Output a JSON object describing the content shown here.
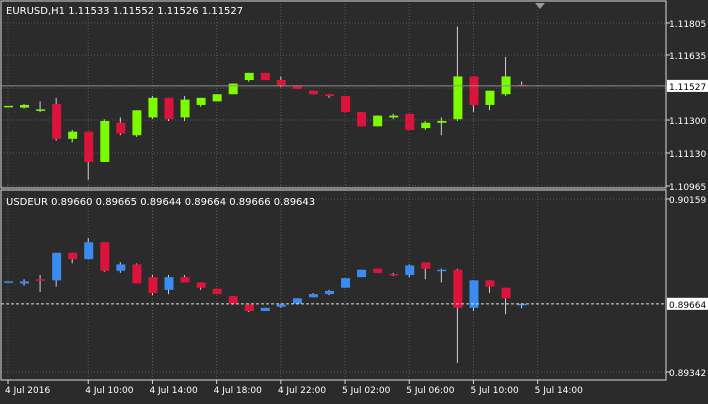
{
  "colors": {
    "background": "#2b2b2b",
    "grid": "#5a5a5a",
    "frame": "#d8d8d8",
    "text": "#ffffff",
    "bull_top": "#7cfc00",
    "bear_top": "#dc143c",
    "bull_bottom": "#3b8cf0",
    "bear_bottom": "#dc143c",
    "level_line": "#8c8c8c",
    "price_tag_bg": "#ffffff",
    "price_tag_text": "#000000"
  },
  "chart_data": [
    {
      "type": "candlestick",
      "title": "EURUSD,H1  1.11533 1.11552 1.11526 1.11527",
      "ylim": [
        1.10965,
        1.1188
      ],
      "yticks": [
        "1.11805",
        "1.11635",
        "1.11470",
        "1.11300",
        "1.11130",
        "1.10965"
      ],
      "current_price": "1.11527",
      "current_price_value": 1.11527,
      "candles": [
        {
          "o": 1.11415,
          "h": 1.11415,
          "l": 1.11415,
          "c": 1.11415
        },
        {
          "o": 1.11405,
          "h": 1.11425,
          "l": 1.114,
          "c": 1.1142
        },
        {
          "o": 1.11395,
          "h": 1.1144,
          "l": 1.1138,
          "c": 1.11395
        },
        {
          "o": 1.11425,
          "h": 1.1146,
          "l": 1.1122,
          "c": 1.1123
        },
        {
          "o": 1.1123,
          "h": 1.1128,
          "l": 1.1121,
          "c": 1.1127
        },
        {
          "o": 1.1127,
          "h": 1.1127,
          "l": 1.11,
          "c": 1.111
        },
        {
          "o": 1.111,
          "h": 1.1134,
          "l": 1.111,
          "c": 1.1133
        },
        {
          "o": 1.1132,
          "h": 1.1135,
          "l": 1.1125,
          "c": 1.1126
        },
        {
          "o": 1.1125,
          "h": 1.1139,
          "l": 1.1124,
          "c": 1.1139
        },
        {
          "o": 1.1135,
          "h": 1.1147,
          "l": 1.1134,
          "c": 1.1146
        },
        {
          "o": 1.1146,
          "h": 1.1146,
          "l": 1.1133,
          "c": 1.1134
        },
        {
          "o": 1.1135,
          "h": 1.1147,
          "l": 1.1133,
          "c": 1.1145
        },
        {
          "o": 1.1142,
          "h": 1.1146,
          "l": 1.1141,
          "c": 1.1146
        },
        {
          "o": 1.1144,
          "h": 1.1148,
          "l": 1.1144,
          "c": 1.1148
        },
        {
          "o": 1.1148,
          "h": 1.1154,
          "l": 1.1148,
          "c": 1.1154
        },
        {
          "o": 1.1156,
          "h": 1.116,
          "l": 1.1155,
          "c": 1.116
        },
        {
          "o": 1.116,
          "h": 1.116,
          "l": 1.1156,
          "c": 1.1156
        },
        {
          "o": 1.1156,
          "h": 1.1158,
          "l": 1.1152,
          "c": 1.1153
        },
        {
          "o": 1.1153,
          "h": 1.1153,
          "l": 1.1151,
          "c": 1.1151
        },
        {
          "o": 1.115,
          "h": 1.115,
          "l": 1.1148,
          "c": 1.1148
        },
        {
          "o": 1.1148,
          "h": 1.1148,
          "l": 1.1146,
          "c": 1.1147
        },
        {
          "o": 1.1147,
          "h": 1.1147,
          "l": 1.1138,
          "c": 1.1138
        },
        {
          "o": 1.1138,
          "h": 1.1138,
          "l": 1.113,
          "c": 1.113
        },
        {
          "o": 1.113,
          "h": 1.1136,
          "l": 1.113,
          "c": 1.1136
        },
        {
          "o": 1.1135,
          "h": 1.1137,
          "l": 1.1134,
          "c": 1.1136
        },
        {
          "o": 1.1137,
          "h": 1.1137,
          "l": 1.1128,
          "c": 1.1128
        },
        {
          "o": 1.1129,
          "h": 1.1133,
          "l": 1.1128,
          "c": 1.1132
        },
        {
          "o": 1.1132,
          "h": 1.1135,
          "l": 1.1125,
          "c": 1.1133
        },
        {
          "o": 1.1134,
          "h": 1.1186,
          "l": 1.1133,
          "c": 1.1158
        },
        {
          "o": 1.1158,
          "h": 1.1158,
          "l": 1.1138,
          "c": 1.1142
        },
        {
          "o": 1.1142,
          "h": 1.115,
          "l": 1.1139,
          "c": 1.115
        },
        {
          "o": 1.1148,
          "h": 1.1169,
          "l": 1.1147,
          "c": 1.1158
        },
        {
          "o": 1.11533,
          "h": 1.11552,
          "l": 1.11526,
          "c": 1.11527
        }
      ]
    },
    {
      "type": "candlestick",
      "title": "USDEUR 0.89660 0.89665 0.89644 0.89664 0.89666 0.89643",
      "ylim": [
        0.89342,
        0.90159
      ],
      "yticks": [
        "0.90159",
        "0.89342"
      ],
      "current_price": "0.89664",
      "current_price_value": 0.89664,
      "candles": [
        {
          "o": 0.8977,
          "h": 0.8977,
          "l": 0.8977,
          "c": 0.8977
        },
        {
          "o": 0.8976,
          "h": 0.8978,
          "l": 0.8975,
          "c": 0.8977
        },
        {
          "o": 0.8978,
          "h": 0.898,
          "l": 0.8972,
          "c": 0.89775
        },
        {
          "o": 0.89775,
          "h": 0.89905,
          "l": 0.89745,
          "c": 0.89905
        },
        {
          "o": 0.89905,
          "h": 0.89905,
          "l": 0.89855,
          "c": 0.89875
        },
        {
          "o": 0.89875,
          "h": 0.89975,
          "l": 0.89875,
          "c": 0.89955
        },
        {
          "o": 0.89955,
          "h": 0.89955,
          "l": 0.89815,
          "c": 0.8982
        },
        {
          "o": 0.8982,
          "h": 0.8986,
          "l": 0.8981,
          "c": 0.8985
        },
        {
          "o": 0.8985,
          "h": 0.89855,
          "l": 0.8976,
          "c": 0.8976
        },
        {
          "o": 0.8979,
          "h": 0.898,
          "l": 0.89705,
          "c": 0.89715
        },
        {
          "o": 0.8973,
          "h": 0.898,
          "l": 0.8971,
          "c": 0.8979
        },
        {
          "o": 0.8979,
          "h": 0.898,
          "l": 0.89765,
          "c": 0.89765
        },
        {
          "o": 0.89765,
          "h": 0.89765,
          "l": 0.8973,
          "c": 0.8974
        },
        {
          "o": 0.89735,
          "h": 0.89735,
          "l": 0.8971,
          "c": 0.8971
        },
        {
          "o": 0.897,
          "h": 0.897,
          "l": 0.8966,
          "c": 0.89665
        },
        {
          "o": 0.8966,
          "h": 0.8966,
          "l": 0.89625,
          "c": 0.8963
        },
        {
          "o": 0.8963,
          "h": 0.89645,
          "l": 0.8963,
          "c": 0.89645
        },
        {
          "o": 0.8965,
          "h": 0.89665,
          "l": 0.89645,
          "c": 0.8966
        },
        {
          "o": 0.89665,
          "h": 0.8969,
          "l": 0.89665,
          "c": 0.8969
        },
        {
          "o": 0.89695,
          "h": 0.89715,
          "l": 0.89695,
          "c": 0.8971
        },
        {
          "o": 0.8971,
          "h": 0.8973,
          "l": 0.89705,
          "c": 0.89725
        },
        {
          "o": 0.8974,
          "h": 0.89785,
          "l": 0.8974,
          "c": 0.89785
        },
        {
          "o": 0.8979,
          "h": 0.89825,
          "l": 0.8979,
          "c": 0.89825
        },
        {
          "o": 0.8983,
          "h": 0.8983,
          "l": 0.8981,
          "c": 0.8981
        },
        {
          "o": 0.89805,
          "h": 0.8981,
          "l": 0.89795,
          "c": 0.898
        },
        {
          "o": 0.898,
          "h": 0.8985,
          "l": 0.8979,
          "c": 0.89845
        },
        {
          "o": 0.8986,
          "h": 0.8986,
          "l": 0.8978,
          "c": 0.8983
        },
        {
          "o": 0.89825,
          "h": 0.8983,
          "l": 0.89765,
          "c": 0.89825
        },
        {
          "o": 0.89825,
          "h": 0.8983,
          "l": 0.89385,
          "c": 0.89645
        },
        {
          "o": 0.89645,
          "h": 0.89775,
          "l": 0.8963,
          "c": 0.89775
        },
        {
          "o": 0.89775,
          "h": 0.89775,
          "l": 0.89715,
          "c": 0.89745
        },
        {
          "o": 0.8974,
          "h": 0.8974,
          "l": 0.89615,
          "c": 0.8969
        },
        {
          "o": 0.8966,
          "h": 0.89666,
          "l": 0.89643,
          "c": 0.89664
        }
      ]
    }
  ],
  "xaxis": {
    "labels": [
      "4 Jul 2016",
      "4 Jul 10:00",
      "4 Jul 14:00",
      "4 Jul 18:00",
      "4 Jul 22:00",
      "5 Jul 02:00",
      "5 Jul 06:00",
      "5 Jul 10:00",
      "5 Jul 14:00"
    ],
    "label_candle_index": [
      0,
      5,
      9,
      13,
      17,
      21,
      25,
      29,
      33
    ]
  },
  "window_controls": {
    "shift_marker_icon": "triangle-down-icon"
  }
}
